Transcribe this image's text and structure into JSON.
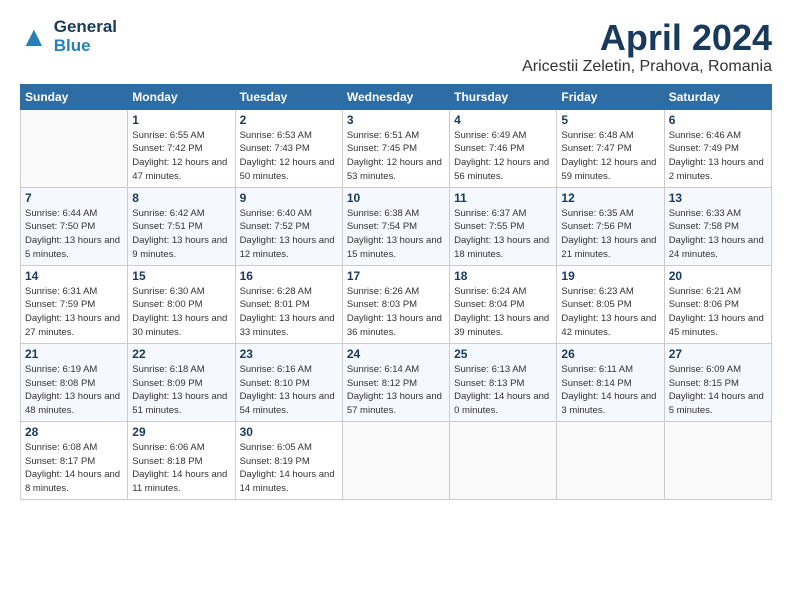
{
  "header": {
    "logo_general": "General",
    "logo_blue": "Blue",
    "title": "April 2024",
    "location": "Aricestii Zeletin, Prahova, Romania"
  },
  "calendar": {
    "days_of_week": [
      "Sunday",
      "Monday",
      "Tuesday",
      "Wednesday",
      "Thursday",
      "Friday",
      "Saturday"
    ],
    "weeks": [
      [
        {
          "day": "",
          "info": ""
        },
        {
          "day": "1",
          "info": "Sunrise: 6:55 AM\nSunset: 7:42 PM\nDaylight: 12 hours\nand 47 minutes."
        },
        {
          "day": "2",
          "info": "Sunrise: 6:53 AM\nSunset: 7:43 PM\nDaylight: 12 hours\nand 50 minutes."
        },
        {
          "day": "3",
          "info": "Sunrise: 6:51 AM\nSunset: 7:45 PM\nDaylight: 12 hours\nand 53 minutes."
        },
        {
          "day": "4",
          "info": "Sunrise: 6:49 AM\nSunset: 7:46 PM\nDaylight: 12 hours\nand 56 minutes."
        },
        {
          "day": "5",
          "info": "Sunrise: 6:48 AM\nSunset: 7:47 PM\nDaylight: 12 hours\nand 59 minutes."
        },
        {
          "day": "6",
          "info": "Sunrise: 6:46 AM\nSunset: 7:49 PM\nDaylight: 13 hours\nand 2 minutes."
        }
      ],
      [
        {
          "day": "7",
          "info": "Sunrise: 6:44 AM\nSunset: 7:50 PM\nDaylight: 13 hours\nand 5 minutes."
        },
        {
          "day": "8",
          "info": "Sunrise: 6:42 AM\nSunset: 7:51 PM\nDaylight: 13 hours\nand 9 minutes."
        },
        {
          "day": "9",
          "info": "Sunrise: 6:40 AM\nSunset: 7:52 PM\nDaylight: 13 hours\nand 12 minutes."
        },
        {
          "day": "10",
          "info": "Sunrise: 6:38 AM\nSunset: 7:54 PM\nDaylight: 13 hours\nand 15 minutes."
        },
        {
          "day": "11",
          "info": "Sunrise: 6:37 AM\nSunset: 7:55 PM\nDaylight: 13 hours\nand 18 minutes."
        },
        {
          "day": "12",
          "info": "Sunrise: 6:35 AM\nSunset: 7:56 PM\nDaylight: 13 hours\nand 21 minutes."
        },
        {
          "day": "13",
          "info": "Sunrise: 6:33 AM\nSunset: 7:58 PM\nDaylight: 13 hours\nand 24 minutes."
        }
      ],
      [
        {
          "day": "14",
          "info": "Sunrise: 6:31 AM\nSunset: 7:59 PM\nDaylight: 13 hours\nand 27 minutes."
        },
        {
          "day": "15",
          "info": "Sunrise: 6:30 AM\nSunset: 8:00 PM\nDaylight: 13 hours\nand 30 minutes."
        },
        {
          "day": "16",
          "info": "Sunrise: 6:28 AM\nSunset: 8:01 PM\nDaylight: 13 hours\nand 33 minutes."
        },
        {
          "day": "17",
          "info": "Sunrise: 6:26 AM\nSunset: 8:03 PM\nDaylight: 13 hours\nand 36 minutes."
        },
        {
          "day": "18",
          "info": "Sunrise: 6:24 AM\nSunset: 8:04 PM\nDaylight: 13 hours\nand 39 minutes."
        },
        {
          "day": "19",
          "info": "Sunrise: 6:23 AM\nSunset: 8:05 PM\nDaylight: 13 hours\nand 42 minutes."
        },
        {
          "day": "20",
          "info": "Sunrise: 6:21 AM\nSunset: 8:06 PM\nDaylight: 13 hours\nand 45 minutes."
        }
      ],
      [
        {
          "day": "21",
          "info": "Sunrise: 6:19 AM\nSunset: 8:08 PM\nDaylight: 13 hours\nand 48 minutes."
        },
        {
          "day": "22",
          "info": "Sunrise: 6:18 AM\nSunset: 8:09 PM\nDaylight: 13 hours\nand 51 minutes."
        },
        {
          "day": "23",
          "info": "Sunrise: 6:16 AM\nSunset: 8:10 PM\nDaylight: 13 hours\nand 54 minutes."
        },
        {
          "day": "24",
          "info": "Sunrise: 6:14 AM\nSunset: 8:12 PM\nDaylight: 13 hours\nand 57 minutes."
        },
        {
          "day": "25",
          "info": "Sunrise: 6:13 AM\nSunset: 8:13 PM\nDaylight: 14 hours\nand 0 minutes."
        },
        {
          "day": "26",
          "info": "Sunrise: 6:11 AM\nSunset: 8:14 PM\nDaylight: 14 hours\nand 3 minutes."
        },
        {
          "day": "27",
          "info": "Sunrise: 6:09 AM\nSunset: 8:15 PM\nDaylight: 14 hours\nand 5 minutes."
        }
      ],
      [
        {
          "day": "28",
          "info": "Sunrise: 6:08 AM\nSunset: 8:17 PM\nDaylight: 14 hours\nand 8 minutes."
        },
        {
          "day": "29",
          "info": "Sunrise: 6:06 AM\nSunset: 8:18 PM\nDaylight: 14 hours\nand 11 minutes."
        },
        {
          "day": "30",
          "info": "Sunrise: 6:05 AM\nSunset: 8:19 PM\nDaylight: 14 hours\nand 14 minutes."
        },
        {
          "day": "",
          "info": ""
        },
        {
          "day": "",
          "info": ""
        },
        {
          "day": "",
          "info": ""
        },
        {
          "day": "",
          "info": ""
        }
      ]
    ]
  }
}
